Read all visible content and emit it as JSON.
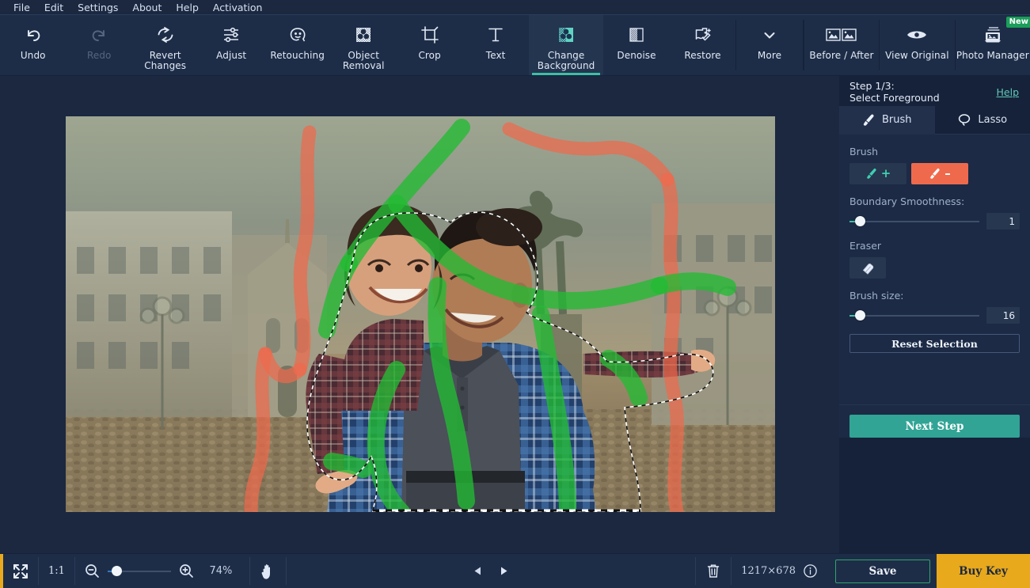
{
  "app": {
    "title": "Movavi Photo Editor",
    "accent": "#3ebfa6",
    "warning": "#e8a91c"
  },
  "menubar": {
    "items": [
      {
        "label": "File"
      },
      {
        "label": "Edit"
      },
      {
        "label": "Settings"
      },
      {
        "label": "About"
      },
      {
        "label": "Help"
      },
      {
        "label": "Activation"
      }
    ]
  },
  "toolbar": {
    "tools": [
      {
        "label": "Undo",
        "icon": "undo-icon",
        "state": "enabled"
      },
      {
        "label": "Redo",
        "icon": "redo-icon",
        "state": "disabled"
      },
      {
        "label": "Revert Changes",
        "icon": "revert-icon",
        "state": "enabled"
      },
      {
        "label": "Adjust",
        "icon": "sliders-icon",
        "state": "enabled"
      },
      {
        "label": "Retouching",
        "icon": "face-icon",
        "state": "enabled"
      },
      {
        "label": "Object Removal",
        "icon": "object-removal-icon",
        "state": "enabled"
      },
      {
        "label": "Crop",
        "icon": "crop-icon",
        "state": "enabled"
      },
      {
        "label": "Text",
        "icon": "text-icon",
        "state": "enabled"
      },
      {
        "label": "Change Background",
        "icon": "change-background-icon",
        "state": "active"
      },
      {
        "label": "Denoise",
        "icon": "denoise-icon",
        "state": "enabled"
      },
      {
        "label": "Restore",
        "icon": "restore-icon",
        "state": "enabled"
      },
      {
        "label": "More",
        "icon": "chevron-down-icon",
        "state": "enabled"
      }
    ],
    "right_tools": [
      {
        "label": "Before / After",
        "icon": "before-after-icon",
        "badge": ""
      },
      {
        "label": "View Original",
        "icon": "eye-icon",
        "badge": ""
      },
      {
        "label": "Photo Manager",
        "icon": "photo-manager-icon",
        "badge": "New"
      }
    ]
  },
  "panel": {
    "step_line1": "Step 1/3:",
    "step_line2": "Select Foreground",
    "help_label": "Help",
    "tabs": [
      {
        "label": "Brush",
        "icon": "brush-icon",
        "active": true
      },
      {
        "label": "Lasso",
        "icon": "lasso-icon",
        "active": false
      }
    ],
    "brush_section_label": "Brush",
    "brush_add_label": "+",
    "brush_remove_label": "–",
    "boundary_label": "Boundary Smoothness:",
    "boundary_value": "1",
    "boundary_percent": 8,
    "eraser_label": "Eraser",
    "brush_size_label": "Brush size:",
    "brush_size_value": "16",
    "brush_size_percent": 8,
    "reset_label": "Reset Selection",
    "next_label": "Next Step"
  },
  "bottombar": {
    "fit_icon": "fit-to-screen-icon",
    "actual_size_label": "1:1",
    "zoom_out_icon": "zoom-out-icon",
    "zoom_in_icon": "zoom-in-icon",
    "zoom_level": "74%",
    "zoom_percent": 14,
    "hand_icon": "hand-tool-icon",
    "prev_icon": "previous-image-icon",
    "next_icon": "next-image-icon",
    "delete_icon": "trash-icon",
    "dimensions": "1217×678",
    "info_icon": "info-icon",
    "save_label": "Save",
    "buy_label": "Buy Key"
  },
  "canvas": {
    "selection_mode": "foreground",
    "foreground_stroke_color": "#22bb33",
    "background_stroke_color": "#ef6a4c",
    "marching_ants": true
  }
}
